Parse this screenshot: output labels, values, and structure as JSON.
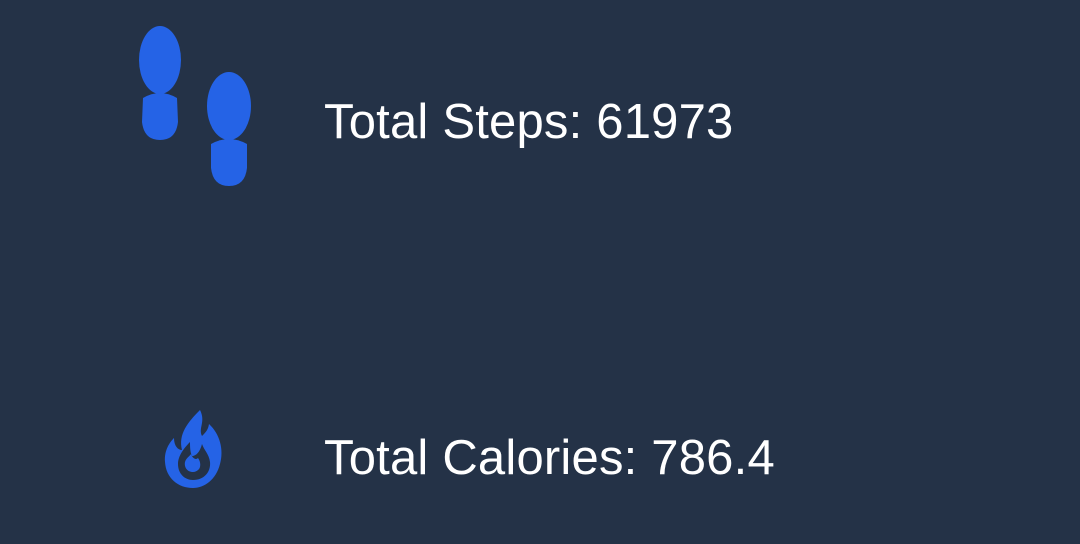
{
  "theme": {
    "background": "#243247",
    "accent": "#2563e6",
    "text": "#ffffff"
  },
  "stats": {
    "steps": {
      "icon": "footsteps-icon",
      "label": "Total Steps: 61973"
    },
    "calories": {
      "icon": "flame-icon",
      "label": "Total Calories: 786.4"
    }
  }
}
